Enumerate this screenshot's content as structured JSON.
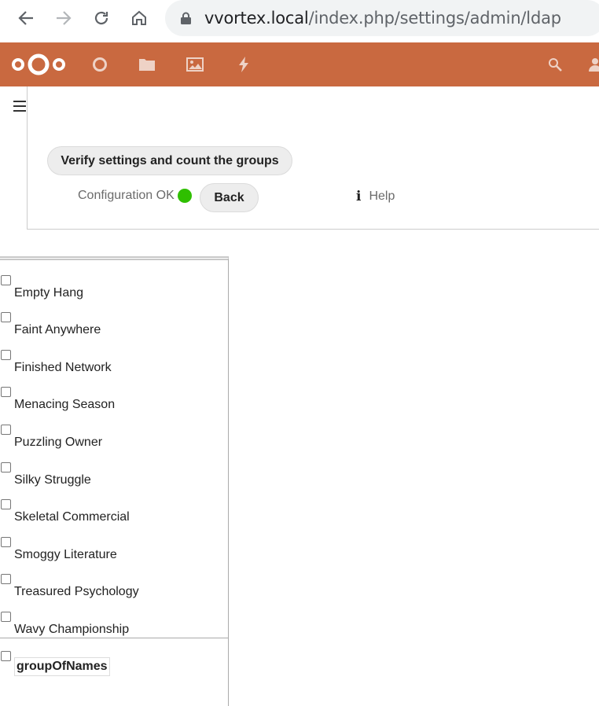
{
  "browser": {
    "url_host": "vvortex.local",
    "url_path": "/index.php/settings/admin/ldap"
  },
  "colors": {
    "header_bg": "#c96940",
    "status_ok": "#2fbf00"
  },
  "header": {
    "apps": [
      "dashboard-icon",
      "files-icon",
      "photos-icon",
      "activity-icon"
    ],
    "right": [
      "search-icon",
      "contacts-icon"
    ]
  },
  "settings": {
    "verify_button": "Verify settings and count the groups",
    "config_status": "Configuration OK",
    "back_button": "Back",
    "help_link": "Help",
    "help_icon": "i"
  },
  "groups": [
    "Empty Hang",
    "Faint Anywhere",
    "Finished Network",
    "Menacing Season",
    "Puzzling Owner",
    "Silky Struggle",
    "Skeletal Commercial",
    "Smoggy Literature",
    "Treasured Psychology",
    "Wavy Championship"
  ],
  "object_classes": [
    "groupOfNames"
  ]
}
